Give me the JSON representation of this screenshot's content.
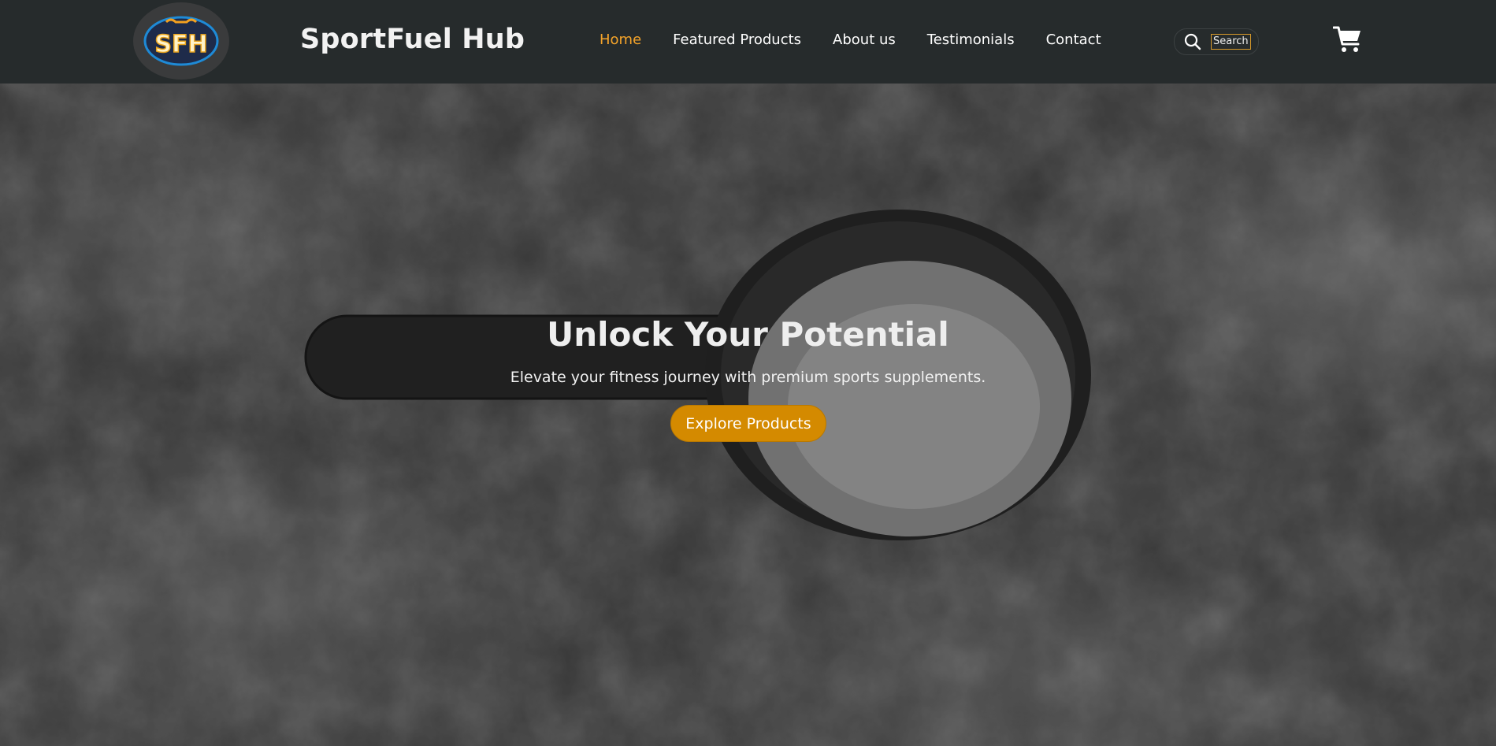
{
  "header": {
    "logo_text": "SFH",
    "brand": "SportFuel Hub",
    "nav": [
      {
        "label": "Home",
        "active": true
      },
      {
        "label": "Featured Products",
        "active": false
      },
      {
        "label": "About us",
        "active": false
      },
      {
        "label": "Testimonials",
        "active": false
      },
      {
        "label": "Contact",
        "active": false
      }
    ],
    "search_label": "Search",
    "search_icon": "search-icon",
    "cart_icon": "cart-icon"
  },
  "hero": {
    "title": "Unlock Your Potential",
    "subtitle": "Elevate your fitness journey with premium sports supplements.",
    "cta_label": "Explore Products"
  },
  "colors": {
    "header_bg": "#262b2c",
    "accent": "#f5a42a",
    "cta": "#d48a00"
  }
}
